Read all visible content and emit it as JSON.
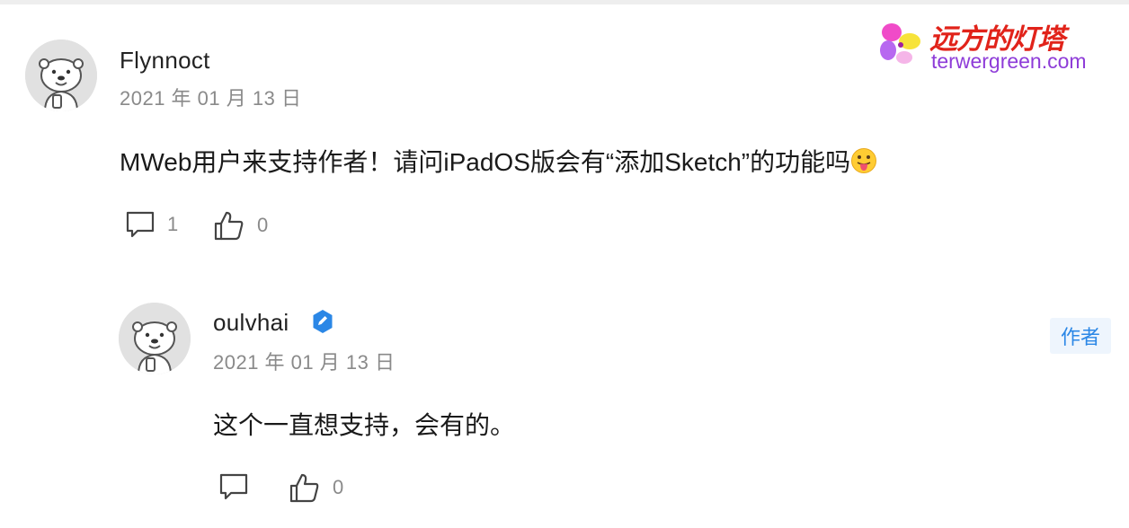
{
  "watermark": {
    "title": "远方的灯塔",
    "url": "terwergreen.com"
  },
  "comment": {
    "author": "Flynnoct",
    "date": "2021 年 01 月 13 日",
    "text": "MWeb用户来支持作者！请问iPadOS版会有“添加Sketch”的功能吗",
    "emoji": "face-with-tongue",
    "reply_count": "1",
    "like_count": "0"
  },
  "reply": {
    "author": "oulvhai",
    "verified": true,
    "badge": "作者",
    "date": "2021 年 01 月 13 日",
    "text": "这个一直想支持，会有的。",
    "like_count": "0"
  },
  "colors": {
    "accent": "#2b87e6",
    "badge_bg": "#eef5fd",
    "muted_text": "#8a8a8a",
    "avatar_bg": "#e1e1e1",
    "watermark_red": "#e1231a",
    "watermark_purple": "#8e3cd8"
  }
}
